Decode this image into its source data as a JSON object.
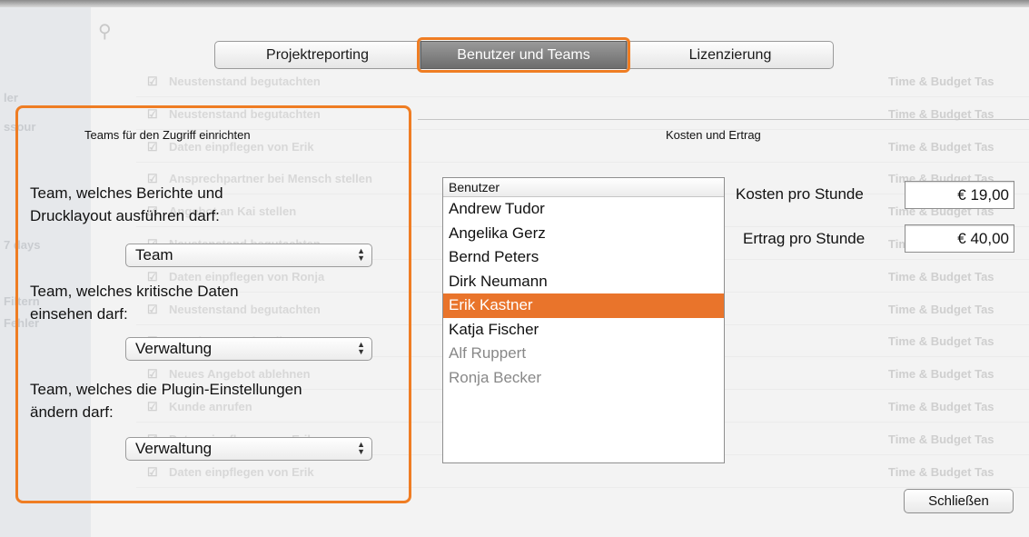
{
  "tabs": [
    {
      "label": "Projektreporting"
    },
    {
      "label": "Benutzer und Teams"
    },
    {
      "label": "Lizenzierung"
    }
  ],
  "teams_section": {
    "title": "Teams für den Zugriff einrichten",
    "reports": {
      "label": "Team, welches Berichte und Drucklayout ausführen darf:",
      "value": "Team"
    },
    "critical": {
      "label": "Team, welches kritische Daten einsehen darf:",
      "value": "Verwaltung"
    },
    "plugin": {
      "label": "Team, welches die Plugin-Einstellungen ändern darf:",
      "value": "Verwaltung"
    }
  },
  "cost_section": {
    "title": "Kosten und Ertrag",
    "users_header": "Benutzer",
    "users": [
      {
        "name": "Andrew Tudor"
      },
      {
        "name": "Angelika Gerz"
      },
      {
        "name": "Bernd Peters"
      },
      {
        "name": "Dirk Neumann"
      },
      {
        "name": "Erik Kastner"
      },
      {
        "name": "Katja Fischer"
      },
      {
        "name": "Alf Ruppert"
      },
      {
        "name": "Ronja Becker"
      }
    ],
    "cost_label": "Kosten pro Stunde",
    "cost_value": "€ 19,00",
    "revenue_label": "Ertrag pro Stunde",
    "revenue_value": "€ 40,00"
  },
  "close_label": "Schließen",
  "background": {
    "sidebar": [
      "ler",
      "ssour",
      "7 days",
      "Filtern",
      "Fehler"
    ],
    "rows": [
      {
        "task": "Neustenstand begutachten",
        "tag": "Time & Budget Tas"
      },
      {
        "task": "Neustenstand begutachten",
        "tag": "Time & Budget Tas"
      },
      {
        "task": "Daten einpflegen von Erik",
        "tag": "Time & Budget Tas"
      },
      {
        "task": "Ansprechpartner bei Mensch stellen",
        "tag": "Time & Budget Tas"
      },
      {
        "task": "Angebot an Kai stellen",
        "tag": "Time & Budget Tas"
      },
      {
        "task": "Neustenstand begutachten",
        "tag": "Time & Budget Tas"
      },
      {
        "task": "Daten einpflegen von Ronja",
        "tag": "Time & Budget Tas"
      },
      {
        "task": "Neustenstand begutachten",
        "tag": "Time & Budget Tas"
      },
      {
        "task": "Angebot an Kai stellen",
        "tag": "Time & Budget Tas"
      },
      {
        "task": "Neues Angebot ablehnen",
        "tag": "Time & Budget Tas"
      },
      {
        "task": "Kunde anrufen",
        "tag": "Time & Budget Tas"
      },
      {
        "task": "Daten einpflegen von Erik",
        "tag": "Time & Budget Tas"
      },
      {
        "task": "Daten einpflegen von Erik",
        "tag": "Time & Budget Tas"
      }
    ]
  },
  "colors": {
    "accent": "#ef7d23",
    "selection": "#e9742b"
  }
}
